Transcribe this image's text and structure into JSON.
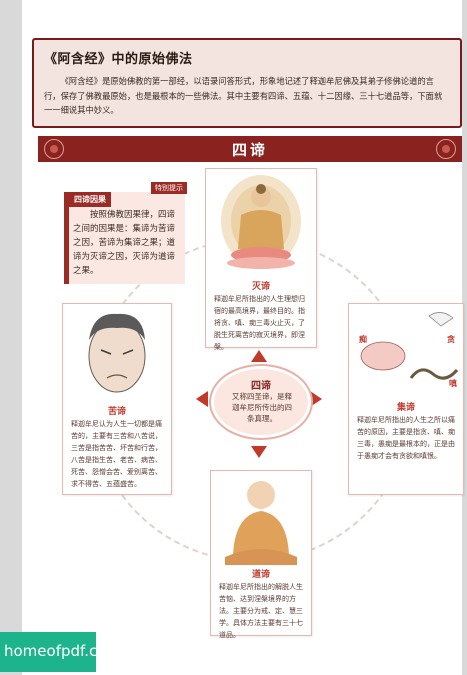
{
  "intro": {
    "title": "《阿含经》中的原始佛法",
    "text": "《阿含经》是原始佛教的第一部经，以语录问答形式，形象地记述了释迦牟尼佛及其弟子修佛论道的言行，保存了佛教最原始，也是最根本的一些佛法。其中主要有四谛、五蕴、十二因缘、三十七道品等，下面就一一细说其中妙义。"
  },
  "banner": {
    "title": "四谛"
  },
  "tip": {
    "badge": "四谛因果",
    "hint": "特别提示",
    "text": "按照佛教因果律，四谛之间的因果是：集谛为苦谛之因，苦谛为集谛之果；道谛为灭谛之因，灭谛为道谛之果。"
  },
  "cards": {
    "mie": {
      "label": "灭谛",
      "text": "释迦牟尼所指出的人生理想归宿的最高境界，最终目的。指将贪、嗔、痴三毒火止灭，了脱生死离苦的寂灭境界，即涅槃。"
    },
    "ku": {
      "label": "苦谛",
      "text": "释迦牟尼认为人生一切都是痛苦的，主要有三苦和八苦说，三苦是指苦苦、坏苦和行苦，八苦是指生苦、老苦、病苦、死苦、怨憎会苦、爱别离苦、求不得苦、五蕴盛苦。"
    },
    "ji": {
      "label": "集谛",
      "text": "释迦牟尼所指出的人生之所以痛苦的原因，主要是指贪、嗔、痴三毒，愚痴是最根本的，正是由于愚痴才会有贪欲和嗔恨。",
      "pig": "痴",
      "bird": "贪",
      "snake": "嗔"
    },
    "dao": {
      "label": "道谛",
      "text": "释迦牟尼所指出的解脱人生苦恼、达到涅槃境界的方法。主要分为戒、定、慧三学。具体方法主要有三十七道品。"
    }
  },
  "center": {
    "title": "四谛",
    "text": "又称四圣谛，是释迦牟尼所传出的四条真理。"
  },
  "footer": {
    "watermark": "homeofpdf.com"
  },
  "colors": {
    "accent": "#8a2320",
    "label": "#c0392b",
    "panel": "#f4e4df",
    "watermark_bg": "#1db38c"
  }
}
